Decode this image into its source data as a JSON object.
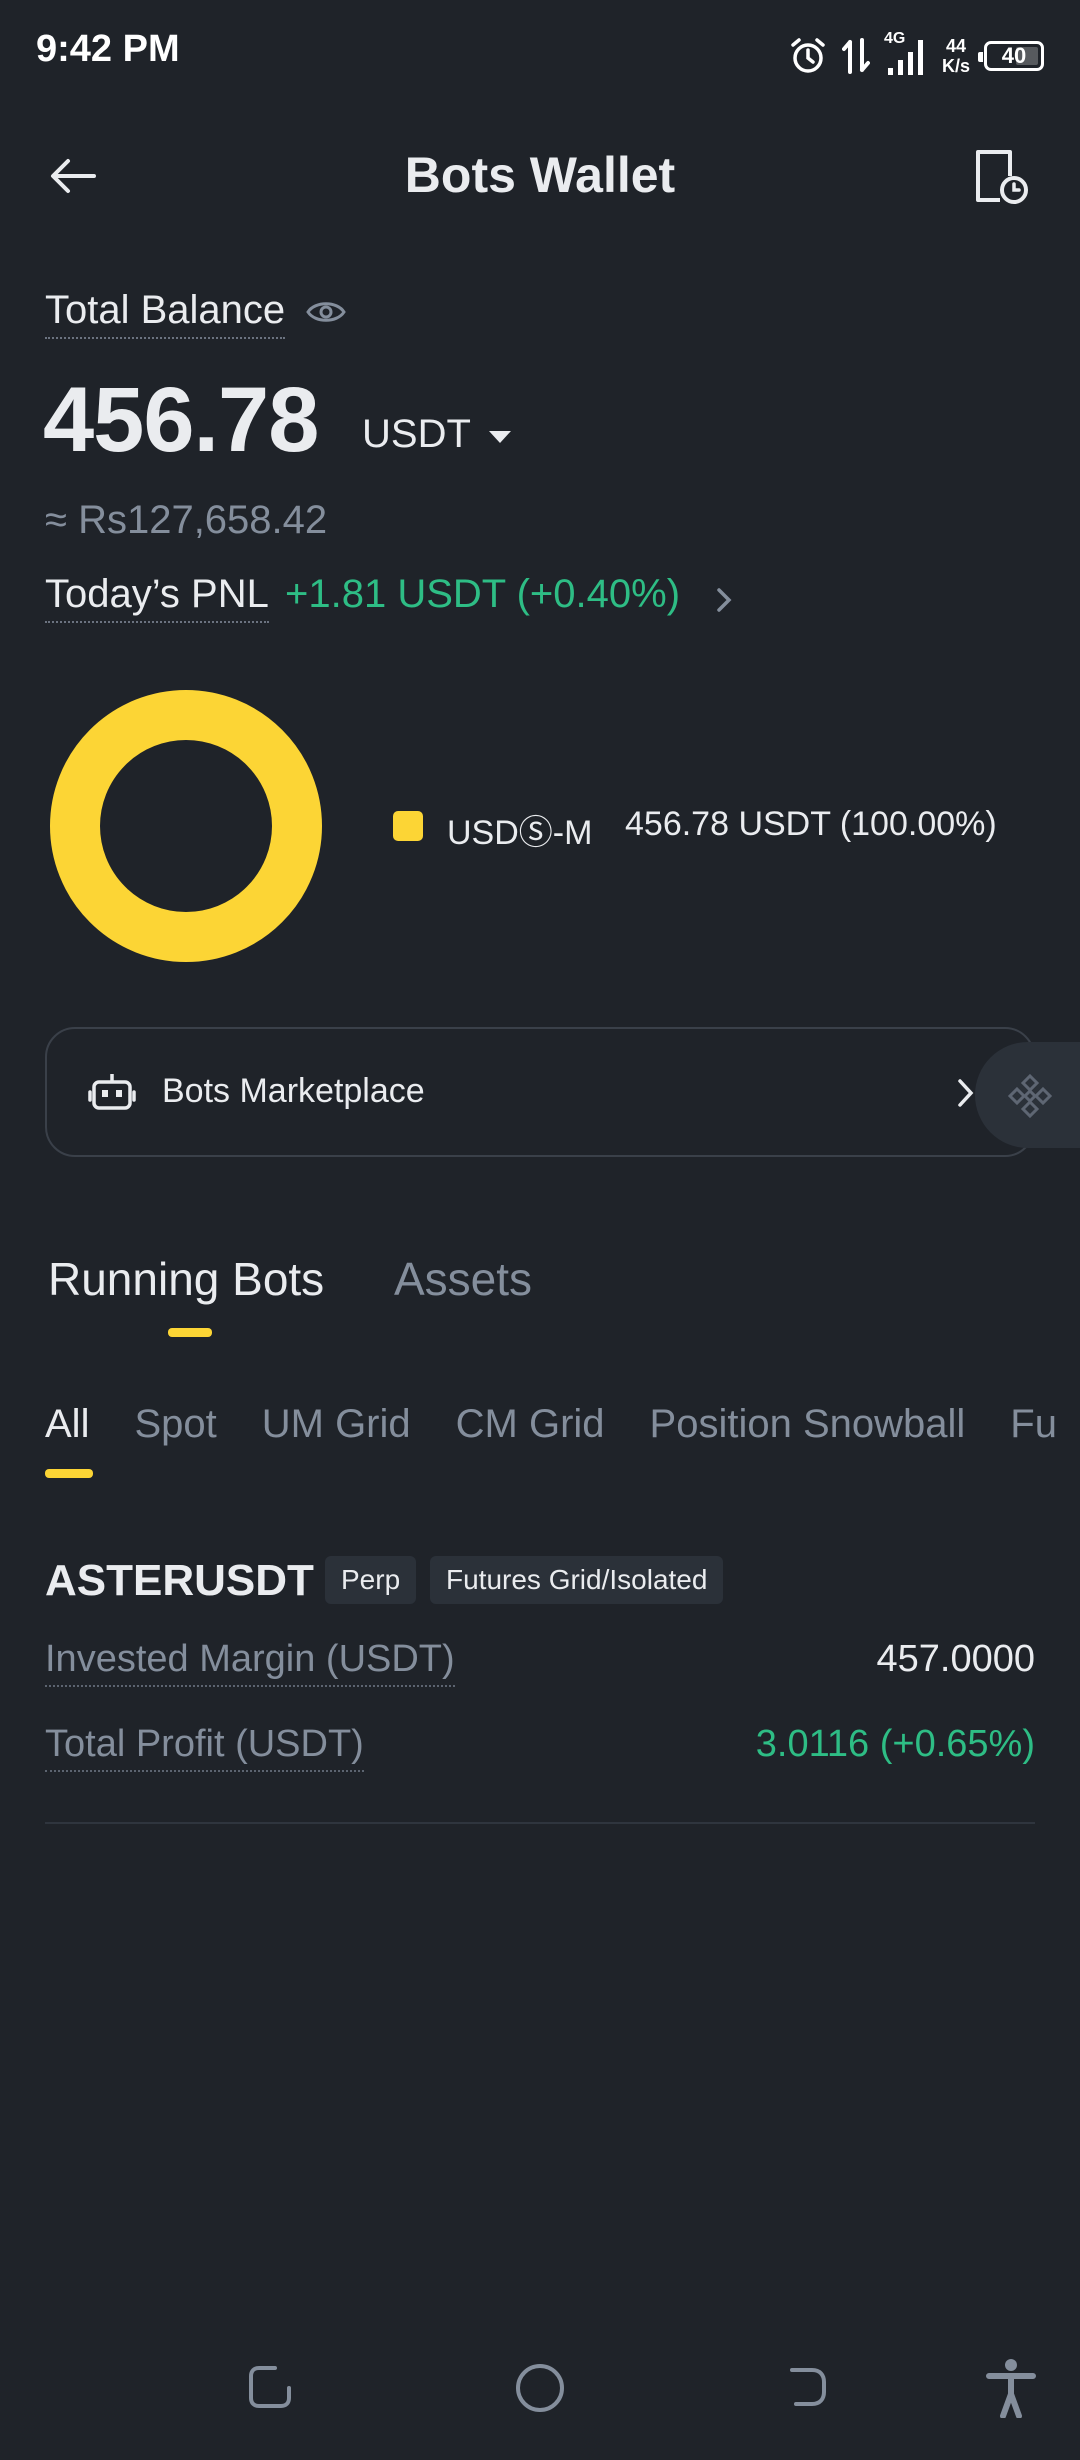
{
  "status_bar": {
    "time": "9:42 PM",
    "network": "4G",
    "speed_value": "44",
    "speed_unit": "K/s",
    "battery": "40",
    "icons": [
      "alarm-icon",
      "data-transfer-icon",
      "signal-icon",
      "battery-icon"
    ]
  },
  "header": {
    "title": "Bots Wallet",
    "back_icon": "arrow-left-icon",
    "history_icon": "document-clock-icon"
  },
  "balance": {
    "label": "Total Balance",
    "amount": "456.78",
    "currency": "USDT",
    "fiat": "≈ Rs127,658.42",
    "pnl_label": "Today’s PNL",
    "pnl_value": "+1.81 USDT (+0.40%)"
  },
  "allocation": {
    "items": [
      {
        "name": "USDⓈ-M",
        "value": "456.78 USDT (100.00%)",
        "percent": 100,
        "color": "#fcd535"
      }
    ]
  },
  "marketplace": {
    "label": "Bots Marketplace"
  },
  "tabs": [
    {
      "label": "Running Bots",
      "active": true
    },
    {
      "label": "Assets",
      "active": false
    }
  ],
  "filters": [
    "All",
    "Spot",
    "UM Grid",
    "CM Grid",
    "Position Snowball",
    "Fu"
  ],
  "bots": [
    {
      "symbol": "ASTERUSDT",
      "tags": [
        "Perp",
        "Futures Grid/Isolated"
      ],
      "invested_label": "Invested Margin (USDT)",
      "invested_value": "457.0000",
      "profit_label": "Total Profit (USDT)",
      "profit_value": "3.0116 (+0.65%)"
    }
  ],
  "colors": {
    "background": "#1f2329",
    "accent": "#fcd535",
    "positive": "#2ebd85",
    "muted": "#848e9c"
  }
}
